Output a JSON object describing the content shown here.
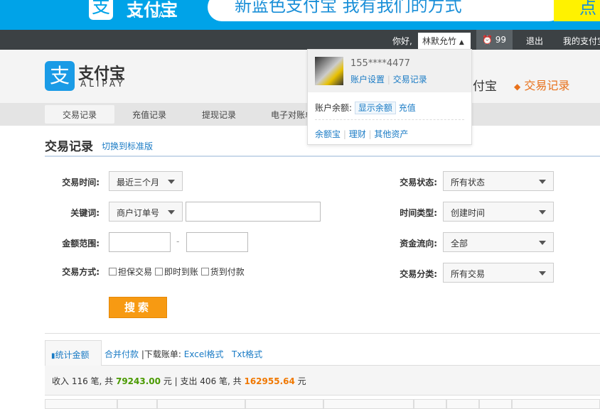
{
  "banner": {
    "logo_char": "支",
    "brand": "支付宝",
    "brand_en": "ALIPAY",
    "slogan": "新蓝色支付宝 我有我们的方式",
    "right_text": "点"
  },
  "topbar": {
    "greeting": "你好,",
    "username": "林默允竹",
    "messages": "99",
    "logout": "退出",
    "my_alipay": "我的支付宝"
  },
  "header": {
    "logo_char": "支",
    "brand": "支付宝",
    "brand_en": "ALIPAY",
    "nav_partial": "付宝",
    "nav_active": "交易记录"
  },
  "subnav": [
    "交易记录",
    "充值记录",
    "提现记录",
    "电子对账单"
  ],
  "dropdown": {
    "phone": "155****4477",
    "account_settings": "账户设置",
    "trade_records": "交易记录",
    "balance_label": "账户余额:",
    "show_balance": "显示余额",
    "recharge": "充值",
    "links": [
      "余额宝",
      "理财",
      "其他资产"
    ]
  },
  "page": {
    "title": "交易记录",
    "switch": "切换到标准版"
  },
  "filters": {
    "time_label": "交易时间:",
    "time_value": "最近三个月",
    "keyword_label": "关键词:",
    "keyword_type": "商户订单号",
    "keyword_value": "",
    "amount_label": "金额范围:",
    "amount_dash": "-",
    "method_label": "交易方式:",
    "methods": [
      "担保交易",
      "即时到账",
      "货到付款"
    ],
    "status_label": "交易状态:",
    "status_value": "所有状态",
    "timetype_label": "时间类型:",
    "timetype_value": "创建时间",
    "flow_label": "资金流向:",
    "flow_value": "全部",
    "category_label": "交易分类:",
    "category_value": "所有交易",
    "search": "搜索"
  },
  "tabs": {
    "stats": "统计金额",
    "merge": "合并付款",
    "download": "|下载账单:",
    "excel": "Excel格式",
    "txt": "Txt格式"
  },
  "stats": {
    "income_prefix": "收入 116 笔, 共 ",
    "income": "79243.00",
    "mid": " 元 | 支出 406 笔, 共 ",
    "expense": "162955.64",
    "suffix": " 元"
  },
  "colors": {
    "income": "#4a9a00",
    "expense": "#f07800",
    "link": "#1a7bc5"
  }
}
